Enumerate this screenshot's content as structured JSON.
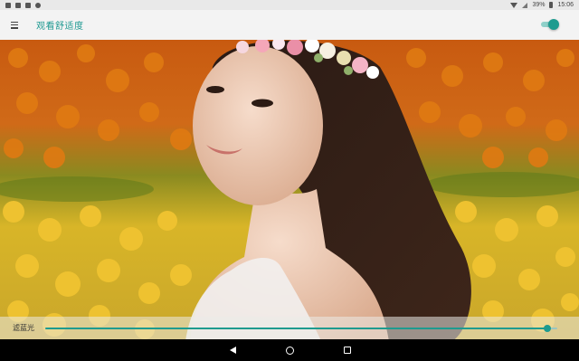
{
  "status_bar": {
    "left_icons": [
      "image-icon",
      "photo-icon",
      "sd-card-icon",
      "circle-icon"
    ],
    "right_icons": [
      "wifi-icon",
      "signal-icon"
    ],
    "battery_percent": "39%",
    "time": "15:06"
  },
  "app_bar": {
    "menu_icon": "hamburger-menu-icon",
    "title": "观看舒适度",
    "toggle_on": true,
    "accent_color": "#1e9b8f"
  },
  "filter": {
    "label": "滤蓝光",
    "level": 0.98
  },
  "nav_bar": {
    "buttons": [
      "back-icon",
      "home-icon",
      "recent-apps-icon"
    ]
  }
}
